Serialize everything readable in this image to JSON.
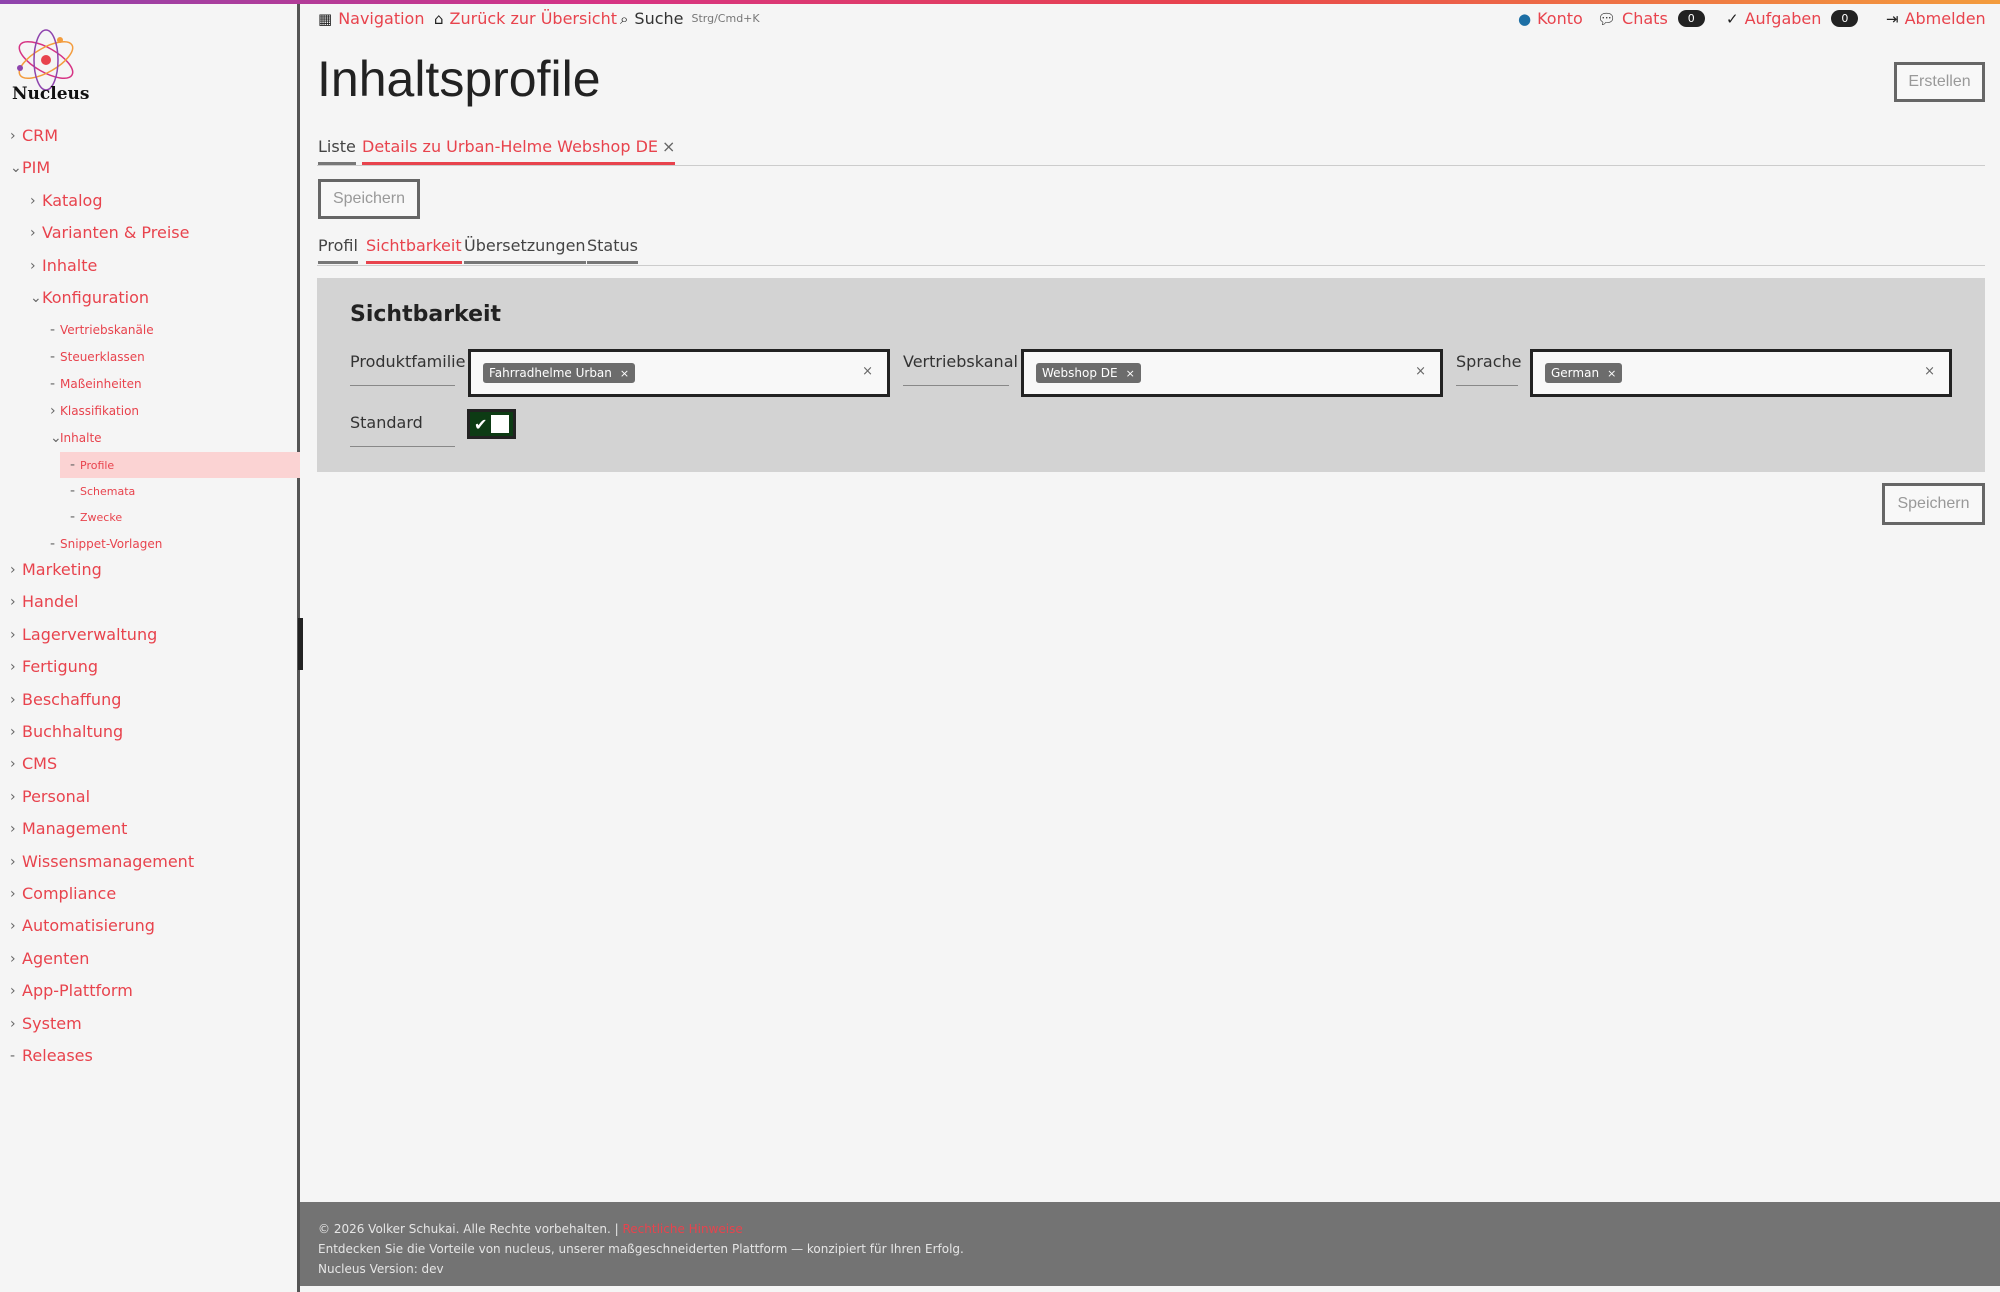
{
  "app": {
    "logo_text": "Nucleus"
  },
  "topbar": {
    "navigation": "Navigation",
    "back": "Zurück zur Übersicht",
    "search": "Suche",
    "search_shortcut": "Strg/Cmd+K",
    "account": "Konto",
    "chats": "Chats",
    "chats_count": "0",
    "tasks": "Aufgaben",
    "tasks_count": "0",
    "logout": "Abmelden"
  },
  "sidebar": {
    "crm": "CRM",
    "pim": "PIM",
    "katalog": "Katalog",
    "varianten": "Varianten & Preise",
    "inhalte": "Inhalte",
    "konfiguration": "Konfiguration",
    "vertriebskanaele": "Vertriebskanäle",
    "steuerklassen": "Steuerklassen",
    "masseinheiten": "Maßeinheiten",
    "klassifikation": "Klassifikation",
    "inhalte_sub": "Inhalte",
    "profile": "Profile",
    "schemata": "Schemata",
    "zwecke": "Zwecke",
    "snippet": "Snippet-Vorlagen",
    "marketing": "Marketing",
    "handel": "Handel",
    "lager": "Lagerverwaltung",
    "fertigung": "Fertigung",
    "beschaffung": "Beschaffung",
    "buchhaltung": "Buchhaltung",
    "cms": "CMS",
    "personal": "Personal",
    "management": "Management",
    "wissen": "Wissensmanagement",
    "compliance": "Compliance",
    "automatisierung": "Automatisierung",
    "agenten": "Agenten",
    "app_plattform": "App-Plattform",
    "system": "System",
    "releases": "Releases"
  },
  "main": {
    "title": "Inhaltsprofile",
    "create_button": "Erstellen",
    "tabs": {
      "list": "Liste",
      "details": "Details zu Urban-Helme Webshop DE",
      "details_close": "×"
    },
    "save_top": "Speichern",
    "subtabs": {
      "profil": "Profil",
      "sichtbarkeit": "Sichtbarkeit",
      "uebersetzungen": "Übersetzungen",
      "status": "Status"
    },
    "panel": {
      "title": "Sichtbarkeit",
      "produktfamilie_label": "Produktfamilie",
      "produktfamilie_value": "Fahrradhelme Urban",
      "vertriebskanal_label": "Vertriebskanal",
      "vertriebskanal_value": "Webshop DE",
      "sprache_label": "Sprache",
      "sprache_value": "German",
      "standard_label": "Standard",
      "standard_checked": true
    },
    "save_bottom": "Speichern"
  },
  "footer": {
    "copyright": "© 2026 Volker Schukai. Alle Rechte vorbehalten. |",
    "legal_link": "Rechtliche Hinweise",
    "tagline": "Entdecken Sie die Vorteile von nucleus, unserer maßgeschneiderten Plattform — konzipiert für Ihren Erfolg.",
    "version": "Nucleus Version: dev"
  },
  "colors": {
    "accent": "#e8434d",
    "panel_bg": "#d3d3d3",
    "footer_bg": "#737373",
    "toggle_on": "#0d3b14"
  }
}
